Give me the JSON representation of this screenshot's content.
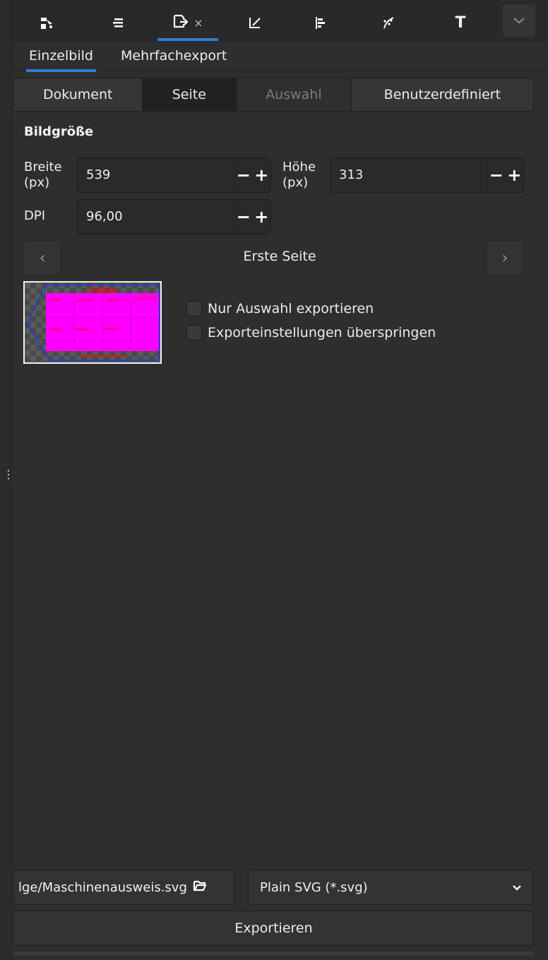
{
  "toolbar": {
    "tabs": [
      {
        "name": "fill-stroke-icon"
      },
      {
        "name": "layers-icon"
      },
      {
        "name": "export-icon",
        "active": true,
        "close": "×"
      },
      {
        "name": "xml-editor-icon"
      },
      {
        "name": "align-icon"
      },
      {
        "name": "path-effects-icon"
      },
      {
        "name": "text-icon",
        "glyph": "T"
      }
    ],
    "more": "chevron-down-icon"
  },
  "export_modes": {
    "single": "Einzelbild",
    "batch": "Mehrfachexport"
  },
  "area_buttons": [
    "Dokument",
    "Seite",
    "Auswahl",
    "Benutzerdefiniert"
  ],
  "image_size": {
    "title": "Bildgröße",
    "width_label_1": "Breite",
    "width_label_2": "(px)",
    "width_value": "539",
    "height_label_1": "Höhe",
    "height_label_2": "(px)",
    "height_value": "313",
    "dpi_label": "DPI",
    "dpi_value": "96,00",
    "minus": "−",
    "plus": "+"
  },
  "pager": {
    "label": "Erste Seite",
    "prev": "‹",
    "next": "›"
  },
  "preview": {
    "heading": "Lukas",
    "cells": [
      "Laser",
      "3D-Druck",
      "Plotter",
      "Transfer­presse",
      "Nähen",
      "Sticken",
      "Holzwerk"
    ],
    "footer": "Maschinenausweis"
  },
  "options": {
    "selection_only": "Nur Auswahl exportieren",
    "skip_settings": "Exporteinstellungen überspringen"
  },
  "footer": {
    "filename": "lge/Maschinenausweis.svg",
    "format": "Plain SVG (*.svg)",
    "export": "Exportieren"
  },
  "colors": {
    "accent": "#2f7fd6",
    "preview_fill": "#ff00ff",
    "preview_text": "#ff0000",
    "preview_outline": "#2440c8"
  }
}
